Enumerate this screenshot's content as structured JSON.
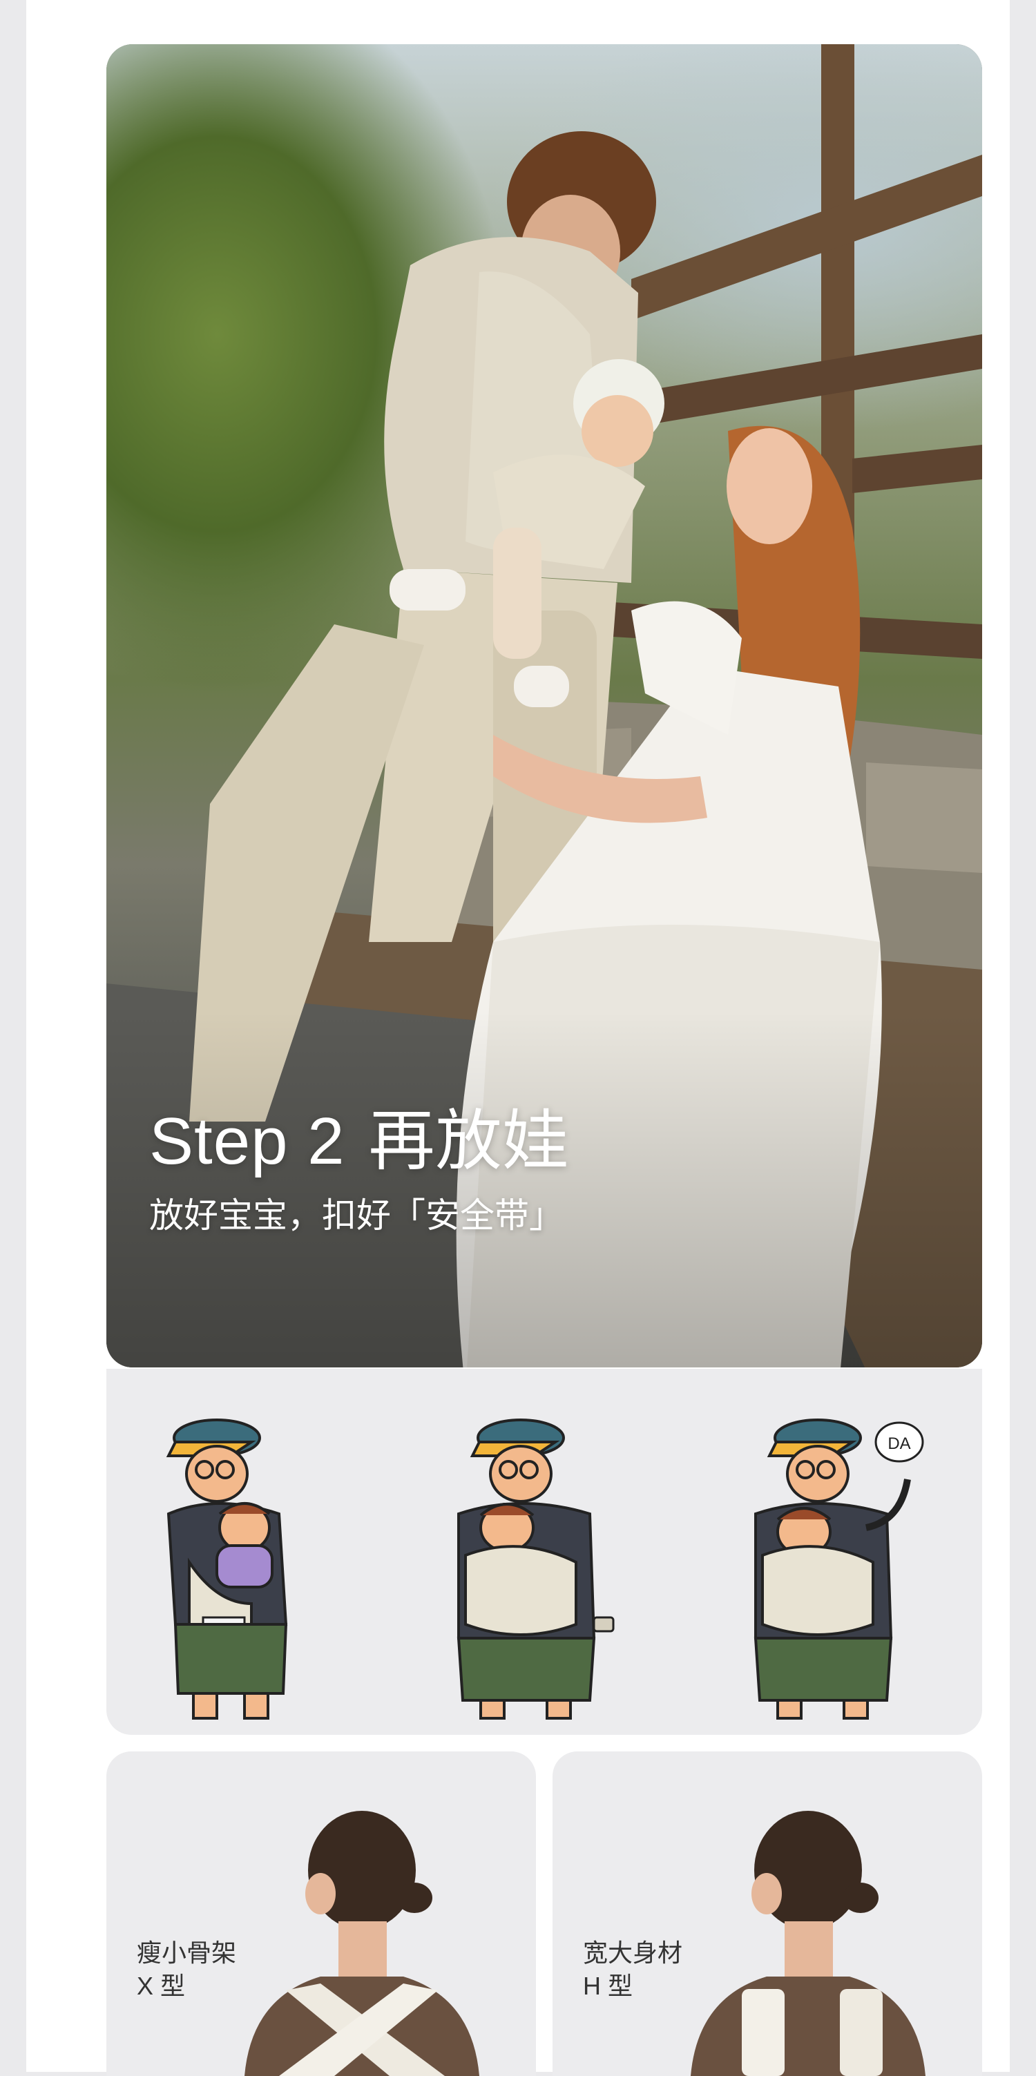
{
  "hero": {
    "step_label": "Step 2",
    "step_title": "再放娃",
    "subtitle": "放好宝宝，扣好「安全带」"
  },
  "illustrations": {
    "speech_bubble": "DA",
    "icons": [
      "parent-with-baby-illustration",
      "buckle-illustration",
      "talking-to-baby-illustration"
    ]
  },
  "body_types": [
    {
      "name": "瘦小骨架",
      "type": "X 型"
    },
    {
      "name": "宽大身材",
      "type": "H 型"
    }
  ],
  "colors": {
    "page_bg": "#eaeaec",
    "card_bg": "#ececee",
    "cap_yellow": "#f2b53a",
    "cap_blue": "#3b6c7c",
    "shorts_green": "#4f6a43",
    "shirt_dark": "#3b3f4a",
    "carrier_beige": "#e8e3d3",
    "sweater_brown": "#6a5140"
  }
}
